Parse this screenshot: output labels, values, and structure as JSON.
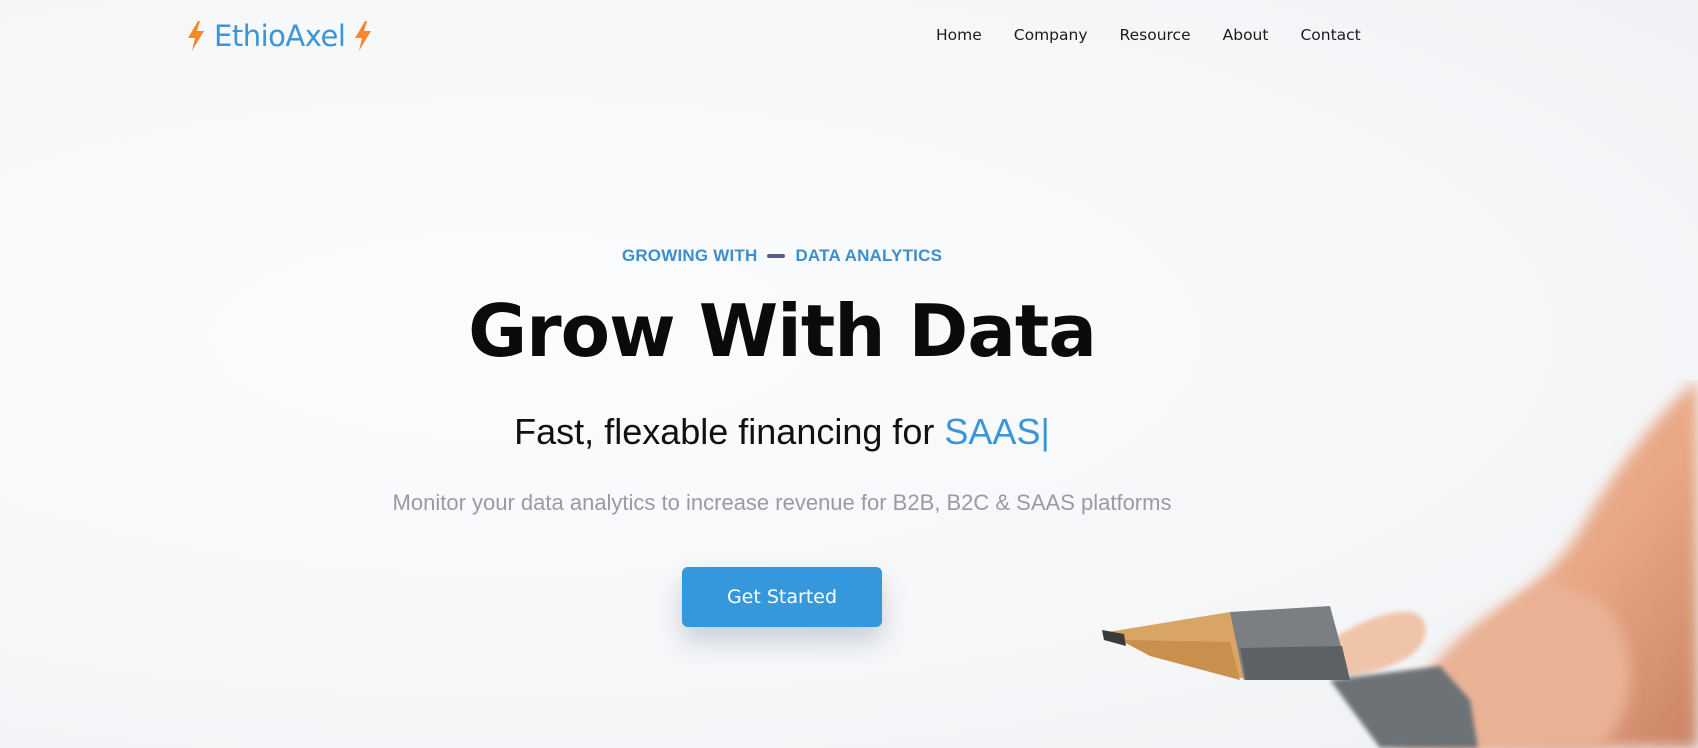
{
  "brand": {
    "name": "EthioAxel",
    "accent_color": "#3a95d9",
    "bolt_color": "#f58a2a",
    "left_icon": "lightning-bolt-icon",
    "right_icon": "lightning-bolt-icon"
  },
  "nav": {
    "items": [
      {
        "label": "Home"
      },
      {
        "label": "Company"
      },
      {
        "label": "Resource"
      },
      {
        "label": "About"
      },
      {
        "label": "Contact"
      }
    ]
  },
  "hero": {
    "eyebrow_left": "GROWING WITH",
    "eyebrow_right": "DATA ANALYTICS",
    "title": "Grow With Data",
    "subtitle_prefix": "Fast, flexable financing for ",
    "subtitle_typed": "SAAS",
    "subtitle_caret": "|",
    "description": "Monitor your data analytics to increase revenue for B2B, B2C & SAAS platforms",
    "cta_label": "Get Started",
    "cta_color": "#3598dc"
  }
}
